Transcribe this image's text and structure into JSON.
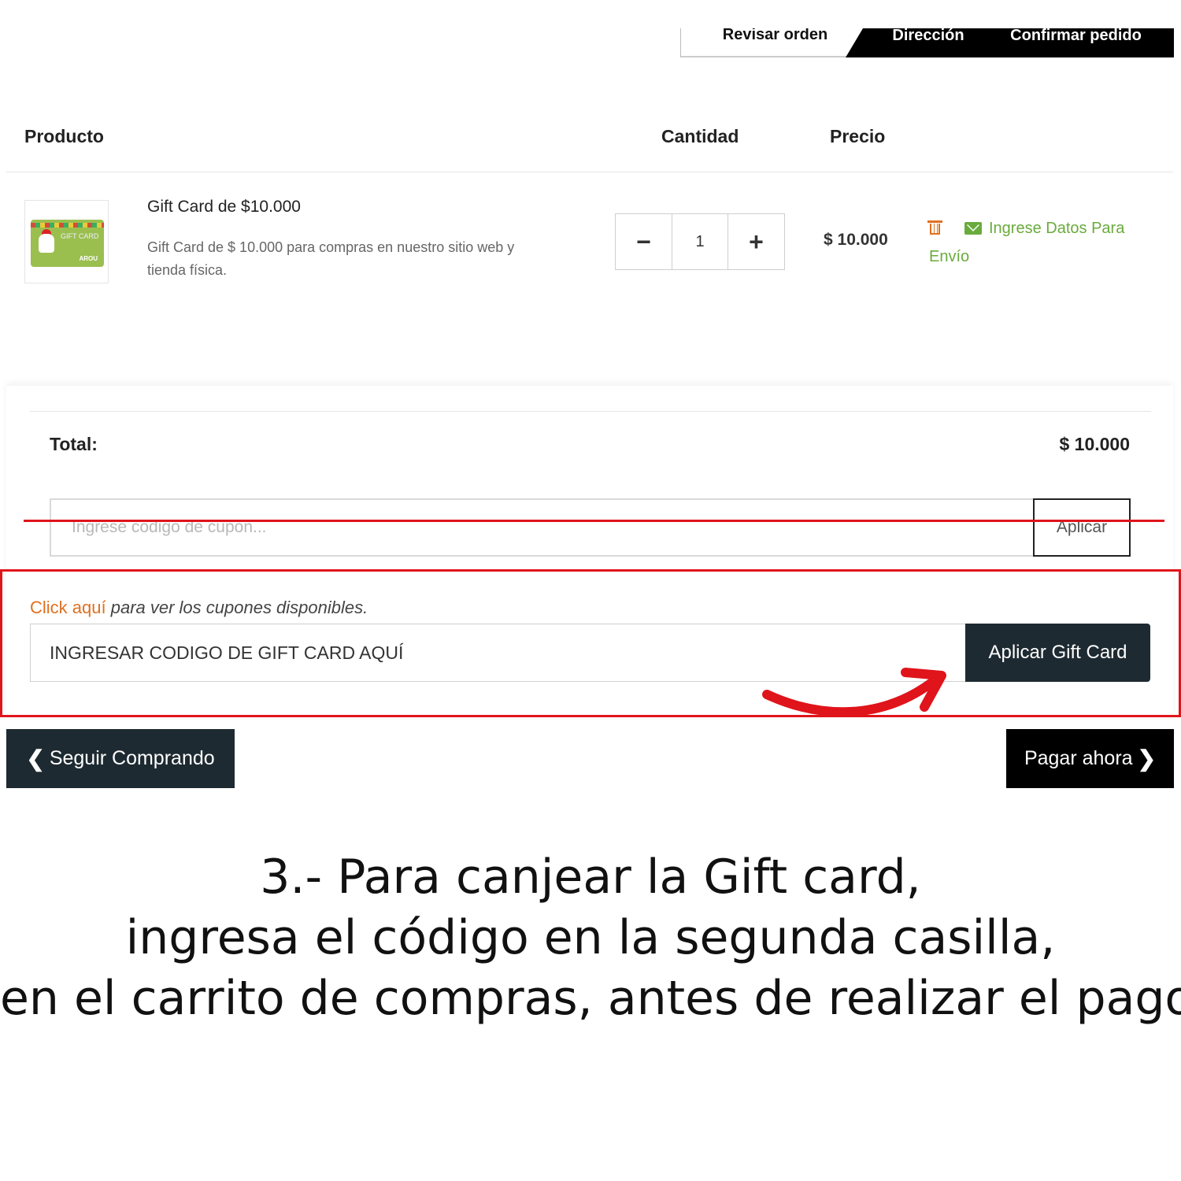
{
  "steps": [
    "Revisar orden",
    "Dirección",
    "Confirmar pedido"
  ],
  "table_headers": {
    "product": "Producto",
    "quantity": "Cantidad",
    "price": "Precio"
  },
  "product": {
    "name": "Gift Card de $10.000",
    "description": "Gift Card de $ 10.000 para compras en nuestro sitio web y tienda física.",
    "thumbnail_text": "GIFT CARD",
    "thumbnail_logo": "AROU",
    "quantity": "1",
    "price": "$ 10.000",
    "shipping_link": "Ingrese Datos Para Envío"
  },
  "totals": {
    "label": "Total:",
    "value": "$ 10.000"
  },
  "coupon": {
    "placeholder": "Ingrese codigo de cupon...",
    "button": "Aplicar"
  },
  "coupons_hint": {
    "link": "Click aquí",
    "text": "para ver los cupones disponibles."
  },
  "gift_card": {
    "placeholder": "INGRESAR CODIGO DE GIFT CARD AQUÍ",
    "button": "Aplicar Gift Card"
  },
  "nav": {
    "back": "Seguir Comprando",
    "pay": "Pagar ahora"
  },
  "caption": [
    "3.- Para canjear la Gift card,",
    "ingresa el código en la segunda casilla,",
    "en el carrito de compras, antes de realizar el pago."
  ],
  "colors": {
    "annotation_red": "#e0141b",
    "accent_green": "#6aab3d",
    "accent_orange": "#e07020",
    "dark_button": "#1e2a31"
  }
}
